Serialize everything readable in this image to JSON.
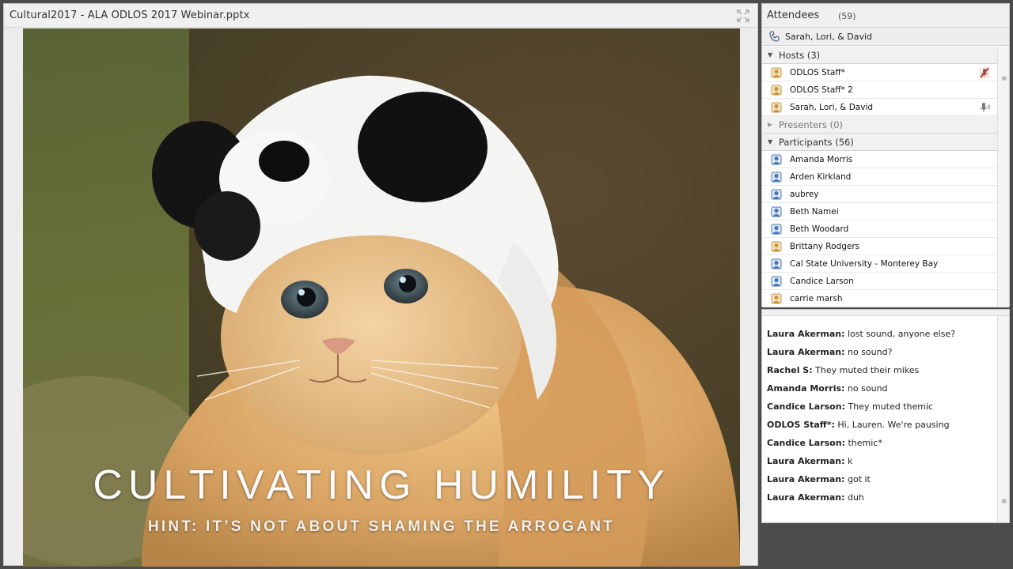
{
  "share_pod": {
    "title": "Cultural2017 - ALA ODLOS 2017 Webinar.pptx",
    "slide": {
      "title": "CULTIVATING HUMILITY",
      "subtitle": "HINT: IT’S NOT ABOUT SHAMING THE ARROGANT"
    }
  },
  "attendees": {
    "title": "Attendees",
    "count": "(59)",
    "phone_line": "Sarah, Lori, & David",
    "groups": {
      "hosts": "Hosts (3)",
      "presenters": "Presenters (0)",
      "participants": "Participants (56)"
    },
    "hosts": [
      {
        "name": "ODLOS Staff*",
        "status": "mic-muted-icon"
      },
      {
        "name": "ODLOS Staff* 2",
        "status": ""
      },
      {
        "name": "Sarah, Lori, & David",
        "status": "mic-active-icon"
      }
    ],
    "participants": [
      {
        "name": "Amanda Morris"
      },
      {
        "name": "Arden Kirkland"
      },
      {
        "name": "aubrey"
      },
      {
        "name": "Beth Namei"
      },
      {
        "name": "Beth Woodard"
      },
      {
        "name": "Brittany Rodgers"
      },
      {
        "name": "Cal State University - Monterey Bay"
      },
      {
        "name": "Candice Larson"
      },
      {
        "name": "carrie marsh"
      }
    ]
  },
  "chat": {
    "messages": [
      {
        "who": "Laura Akerman:",
        "text": " lost sound, anyone else?"
      },
      {
        "who": "Laura Akerman:",
        "text": " no sound?"
      },
      {
        "who": "Rachel S:",
        "text": " They muted their mikes"
      },
      {
        "who": "Amanda Morris:",
        "text": " no sound"
      },
      {
        "who": "Candice Larson:",
        "text": " They muted themic"
      },
      {
        "who": "ODLOS Staff*:",
        "text": " Hi, Lauren. We're pausing"
      },
      {
        "who": "Candice Larson:",
        "text": " themic*"
      },
      {
        "who": "Laura Akerman:",
        "text": " k"
      },
      {
        "who": "Laura Akerman:",
        "text": " got it"
      },
      {
        "who": "Laura Akerman:",
        "text": " duh"
      }
    ]
  },
  "colors": {
    "host_icon": "#c8963c",
    "participant_icon": "#4a78b5",
    "muted_red": "#c0392b"
  }
}
